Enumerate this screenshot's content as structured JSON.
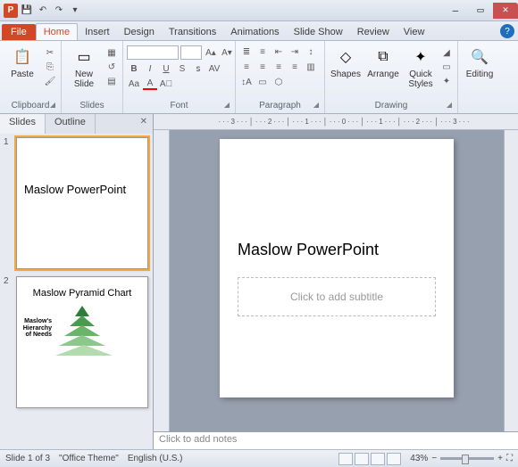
{
  "qat": {
    "save": "💾",
    "undo": "↶",
    "redo": "↷"
  },
  "tabs": {
    "file": "File",
    "home": "Home",
    "insert": "Insert",
    "design": "Design",
    "transitions": "Transitions",
    "animations": "Animations",
    "slideshow": "Slide Show",
    "review": "Review",
    "view": "View"
  },
  "ribbon": {
    "clipboard": {
      "label": "Clipboard",
      "paste": "Paste"
    },
    "slides": {
      "label": "Slides",
      "new": "New\nSlide"
    },
    "font": {
      "label": "Font"
    },
    "paragraph": {
      "label": "Paragraph"
    },
    "drawing": {
      "label": "Drawing",
      "shapes": "Shapes",
      "arrange": "Arrange",
      "quick": "Quick\nStyles"
    },
    "editing": {
      "label": "Editing",
      "btn": "Editing"
    }
  },
  "panel": {
    "slides_tab": "Slides",
    "outline_tab": "Outline"
  },
  "thumbs": [
    {
      "num": "1",
      "title": "Maslow PowerPoint"
    },
    {
      "num": "2",
      "title": "Maslow Pyramid Chart",
      "pyr_label": "Maslow's Hierarchy of Needs"
    }
  ],
  "slide": {
    "title": "Maslow PowerPoint",
    "subtitle_placeholder": "Click to add subtitle"
  },
  "notes": {
    "placeholder": "Click to add notes"
  },
  "status": {
    "slide": "Slide 1 of 3",
    "theme": "\"Office Theme\"",
    "lang": "English (U.S.)",
    "zoom": "43%"
  },
  "ruler_text": "···3···│···2···│···1···│···0···│···1···│···2···│···3···"
}
